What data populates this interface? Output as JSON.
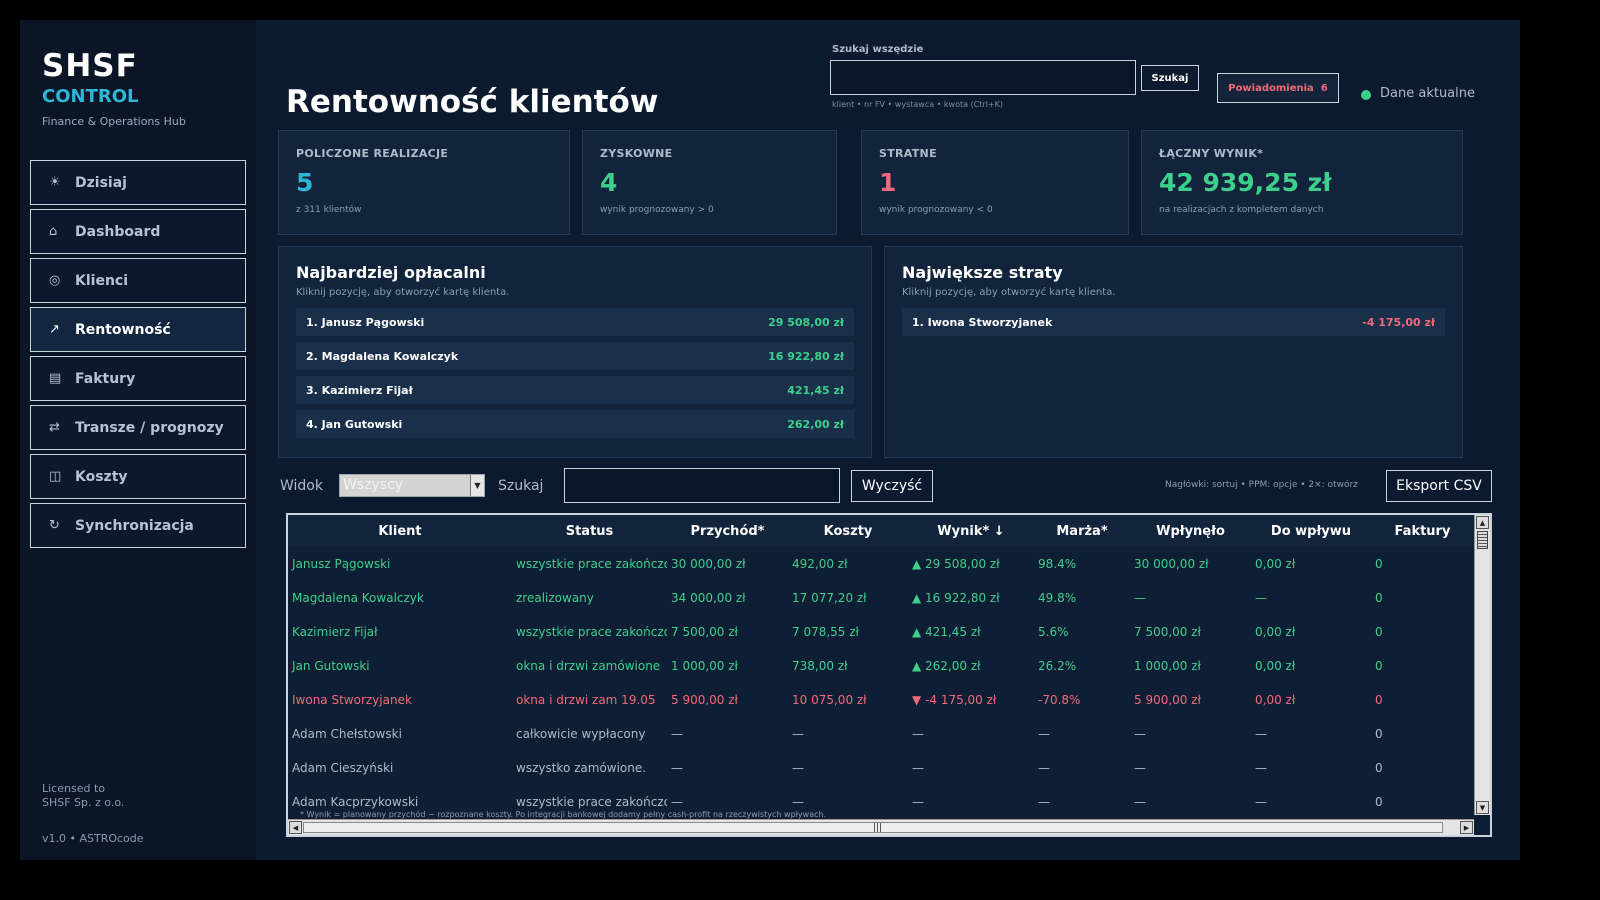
{
  "brand": {
    "title": "SHSF",
    "subtitle": "CONTROL",
    "tagline": "Finance & Operations Hub"
  },
  "nav": [
    {
      "icon": "sun-icon",
      "glyph": "☀",
      "label": "Dzisiaj",
      "active": false
    },
    {
      "icon": "home-icon",
      "glyph": "⌂",
      "label": "Dashboard",
      "active": false
    },
    {
      "icon": "target-icon",
      "glyph": "◎",
      "label": "Klienci",
      "active": false
    },
    {
      "icon": "trend-up-icon",
      "glyph": "↗",
      "label": "Rentowność",
      "active": true
    },
    {
      "icon": "document-icon",
      "glyph": "▤",
      "label": "Faktury",
      "active": false
    },
    {
      "icon": "transfer-icon",
      "glyph": "⇄",
      "label": "Transze / prognozy",
      "active": false
    },
    {
      "icon": "wallet-icon",
      "glyph": "◫",
      "label": "Koszty",
      "active": false
    },
    {
      "icon": "sync-icon",
      "glyph": "↻",
      "label": "Synchronizacja",
      "active": false
    }
  ],
  "license": {
    "line1": "Licensed to",
    "line2": "SHSF Sp. z o.o.",
    "version": "v1.0 • ASTROcode"
  },
  "header": {
    "title": "Rentowność klientów",
    "search_label": "Szukaj wszędzie",
    "search_value": "",
    "search_button": "Szukaj",
    "search_hint": "klient • nr FV • wystawca • kwota   (Ctrl+K)",
    "notifications_label": "Powiadomienia",
    "notifications_count": "6",
    "status_text": "Dane aktualne"
  },
  "colors": {
    "accent": "#2cb6d8",
    "positive": "#3dcf8c",
    "negative": "#f06a78",
    "background": "#0c1a30"
  },
  "kpis": [
    {
      "label": "POLICZONE REALIZACJE",
      "value": "5",
      "sub": "z 311 klientów",
      "color": "#2cb6d8"
    },
    {
      "label": "ZYSKOWNE",
      "value": "4",
      "sub": "wynik prognozowany > 0",
      "color": "#3dcf8c"
    },
    {
      "label": "STRATNE",
      "value": "1",
      "sub": "wynik prognozowany < 0",
      "color": "#f06a78"
    },
    {
      "label": "ŁĄCZNY WYNIK*",
      "value": "42 939,25 zł",
      "sub": "na realizacjach z kompletem danych",
      "color": "#3dcf8c"
    }
  ],
  "top_panel": {
    "title": "Najbardziej opłacalni",
    "sub": "Kliknij pozycję, aby otworzyć kartę klienta.",
    "items": [
      {
        "name": "1. Janusz Pągowski",
        "value": "29 508,00 zł"
      },
      {
        "name": "2. Magdalena Kowalczyk",
        "value": "16 922,80 zł"
      },
      {
        "name": "3. Kazimierz Fijał",
        "value": "421,45 zł"
      },
      {
        "name": "4. Jan Gutowski",
        "value": "262,00 zł"
      }
    ]
  },
  "loss_panel": {
    "title": "Największe straty",
    "sub": "Kliknij pozycję, aby otworzyć kartę klienta.",
    "items": [
      {
        "name": "1. Iwona Stworzyjanek",
        "value": "-4 175,00 zł"
      }
    ]
  },
  "filters": {
    "view_label": "Widok",
    "view_selected": "Wszyscy",
    "search_label": "Szukaj",
    "search_value": "",
    "clear_button": "Wyczyść",
    "hint": "Nagłówki: sortuj  •  PPM: opcje  •  2×: otwórz",
    "export_button": "Eksport CSV"
  },
  "table": {
    "columns": [
      "Klient",
      "Status",
      "Przychód*",
      "Koszty",
      "Wynik*  ↓",
      "Marża*",
      "Wpłynęło",
      "Do wpływu",
      "Faktury"
    ],
    "rows": [
      {
        "kind": "pos",
        "cells": [
          "Janusz Pągowski",
          "wszystkie prace zakończone",
          "30 000,00 zł",
          "492,00 zł",
          "▲ 29 508,00 zł",
          "98.4%",
          "30 000,00 zł",
          "0,00 zł",
          "0"
        ]
      },
      {
        "kind": "pos",
        "cells": [
          "Magdalena Kowalczyk",
          "zrealizowany",
          "34 000,00 zł",
          "17 077,20 zł",
          "▲ 16 922,80 zł",
          "49.8%",
          "—",
          "—",
          "0"
        ]
      },
      {
        "kind": "pos",
        "cells": [
          "Kazimierz Fijał",
          "wszystkie prace zakończone",
          "7 500,00 zł",
          "7 078,55 zł",
          "▲ 421,45 zł",
          "5.6%",
          "7 500,00 zł",
          "0,00 zł",
          "0"
        ]
      },
      {
        "kind": "pos",
        "cells": [
          "Jan Gutowski",
          "okna i drzwi zamówione",
          "1 000,00 zł",
          "738,00 zł",
          "▲ 262,00 zł",
          "26.2%",
          "1 000,00 zł",
          "0,00 zł",
          "0"
        ]
      },
      {
        "kind": "neg",
        "cells": [
          "Iwona Stworzyjanek",
          "okna i drzwi zam 19.05",
          "5 900,00 zł",
          "10 075,00 zł",
          "▼ -4 175,00 zł",
          "-70.8%",
          "5 900,00 zł",
          "0,00 zł",
          "0"
        ]
      },
      {
        "kind": "neutral",
        "cells": [
          "Adam Chełstowski",
          "całkowicie wypłacony",
          "—",
          "—",
          "—",
          "—",
          "—",
          "—",
          "0"
        ]
      },
      {
        "kind": "neutral",
        "cells": [
          "Adam Cieszyński",
          "wszystko zamówione.",
          "—",
          "—",
          "—",
          "—",
          "—",
          "—",
          "0"
        ]
      },
      {
        "kind": "neutral",
        "cells": [
          "Adam Kacprzykowski",
          "wszystkie prace zakończone",
          "—",
          "—",
          "—",
          "—",
          "—",
          "—",
          "0"
        ]
      }
    ],
    "footnote": "* Wynik = planowany przychód − rozpoznane koszty. Po integracji bankowej dodamy pełny cash-profit na rzeczywistych wpływach."
  }
}
